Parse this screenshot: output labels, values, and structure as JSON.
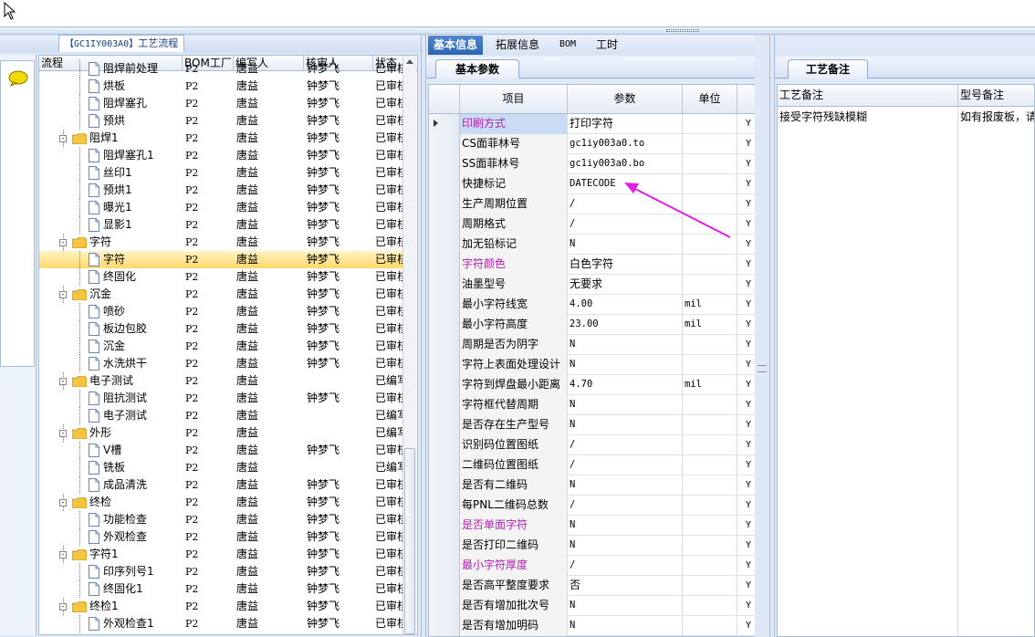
{
  "left": {
    "title_code": "【GC1IY003A0】",
    "title_text": "工艺流程",
    "columns": [
      "流程",
      "BOM工厂",
      "编写人",
      "核审人",
      "状态"
    ],
    "rows": [
      {
        "level": 2,
        "type": "doc",
        "name": "阻焊前处理",
        "bom": "P2",
        "author": "唐益",
        "reviewer": "钟梦飞",
        "status": "已审核"
      },
      {
        "level": 2,
        "type": "doc",
        "name": "烘板",
        "bom": "P2",
        "author": "唐益",
        "reviewer": "钟梦飞",
        "status": "已审核"
      },
      {
        "level": 2,
        "type": "doc",
        "name": "阻焊塞孔",
        "bom": "P2",
        "author": "唐益",
        "reviewer": "钟梦飞",
        "status": "已审核"
      },
      {
        "level": 2,
        "type": "doc",
        "name": "预烘",
        "bom": "P2",
        "author": "唐益",
        "reviewer": "钟梦飞",
        "status": "已审核"
      },
      {
        "level": 1,
        "type": "folder",
        "name": "阻焊1",
        "bom": "P2",
        "author": "唐益",
        "reviewer": "钟梦飞",
        "status": "已审核"
      },
      {
        "level": 2,
        "type": "doc",
        "name": "阻焊塞孔1",
        "bom": "P2",
        "author": "唐益",
        "reviewer": "钟梦飞",
        "status": "已审核"
      },
      {
        "level": 2,
        "type": "doc",
        "name": "丝印1",
        "bom": "P2",
        "author": "唐益",
        "reviewer": "钟梦飞",
        "status": "已审核"
      },
      {
        "level": 2,
        "type": "doc",
        "name": "预烘1",
        "bom": "P2",
        "author": "唐益",
        "reviewer": "钟梦飞",
        "status": "已审核"
      },
      {
        "level": 2,
        "type": "doc",
        "name": "曝光1",
        "bom": "P2",
        "author": "唐益",
        "reviewer": "钟梦飞",
        "status": "已审核"
      },
      {
        "level": 2,
        "type": "doc",
        "name": "显影1",
        "bom": "P2",
        "author": "唐益",
        "reviewer": "钟梦飞",
        "status": "已审核"
      },
      {
        "level": 1,
        "type": "folder",
        "name": "字符",
        "bom": "P2",
        "author": "唐益",
        "reviewer": "钟梦飞",
        "status": "已审核"
      },
      {
        "level": 2,
        "type": "doc",
        "name": "字符",
        "bom": "P2",
        "author": "唐益",
        "reviewer": "钟梦飞",
        "status": "已审核",
        "selected": true
      },
      {
        "level": 2,
        "type": "doc",
        "name": "终固化",
        "bom": "P2",
        "author": "唐益",
        "reviewer": "钟梦飞",
        "status": "已审核"
      },
      {
        "level": 1,
        "type": "folder",
        "name": "沉金",
        "bom": "P2",
        "author": "唐益",
        "reviewer": "钟梦飞",
        "status": "已审核"
      },
      {
        "level": 2,
        "type": "doc",
        "name": "喷砂",
        "bom": "P2",
        "author": "唐益",
        "reviewer": "钟梦飞",
        "status": "已审核"
      },
      {
        "level": 2,
        "type": "doc",
        "name": "板边包胶",
        "bom": "P2",
        "author": "唐益",
        "reviewer": "钟梦飞",
        "status": "已审核"
      },
      {
        "level": 2,
        "type": "doc",
        "name": "沉金",
        "bom": "P2",
        "author": "唐益",
        "reviewer": "钟梦飞",
        "status": "已审核"
      },
      {
        "level": 2,
        "type": "doc",
        "name": "水洗烘干",
        "bom": "P2",
        "author": "唐益",
        "reviewer": "钟梦飞",
        "status": "已审核"
      },
      {
        "level": 1,
        "type": "folder",
        "name": "电子测试",
        "bom": "P2",
        "author": "唐益",
        "reviewer": "",
        "status": "已编写"
      },
      {
        "level": 2,
        "type": "doc",
        "name": "阻抗测试",
        "bom": "P2",
        "author": "唐益",
        "reviewer": "钟梦飞",
        "status": "已审核"
      },
      {
        "level": 2,
        "type": "doc",
        "name": "电子测试",
        "bom": "P2",
        "author": "唐益",
        "reviewer": "",
        "status": "已编写"
      },
      {
        "level": 1,
        "type": "folder",
        "name": "外形",
        "bom": "P2",
        "author": "唐益",
        "reviewer": "",
        "status": "已编写"
      },
      {
        "level": 2,
        "type": "doc",
        "name": "V槽",
        "bom": "P2",
        "author": "唐益",
        "reviewer": "钟梦飞",
        "status": "已审核"
      },
      {
        "level": 2,
        "type": "doc",
        "name": "铣板",
        "bom": "P2",
        "author": "唐益",
        "reviewer": "",
        "status": "已编写"
      },
      {
        "level": 2,
        "type": "doc",
        "name": "成品清洗",
        "bom": "P2",
        "author": "唐益",
        "reviewer": "钟梦飞",
        "status": "已审核"
      },
      {
        "level": 1,
        "type": "folder",
        "name": "终检",
        "bom": "P2",
        "author": "唐益",
        "reviewer": "钟梦飞",
        "status": "已审核"
      },
      {
        "level": 2,
        "type": "doc",
        "name": "功能检查",
        "bom": "P2",
        "author": "唐益",
        "reviewer": "钟梦飞",
        "status": "已审核"
      },
      {
        "level": 2,
        "type": "doc",
        "name": "外观检查",
        "bom": "P2",
        "author": "唐益",
        "reviewer": "钟梦飞",
        "status": "已审核"
      },
      {
        "level": 1,
        "type": "folder",
        "name": "字符1",
        "bom": "P2",
        "author": "唐益",
        "reviewer": "钟梦飞",
        "status": "已审核"
      },
      {
        "level": 2,
        "type": "doc",
        "name": "印序列号1",
        "bom": "P2",
        "author": "唐益",
        "reviewer": "钟梦飞",
        "status": "已审核"
      },
      {
        "level": 2,
        "type": "doc",
        "name": "终固化1",
        "bom": "P2",
        "author": "唐益",
        "reviewer": "钟梦飞",
        "status": "已审核"
      },
      {
        "level": 1,
        "type": "folder",
        "name": "终检1",
        "bom": "P2",
        "author": "唐益",
        "reviewer": "钟梦飞",
        "status": "已审核"
      },
      {
        "level": 2,
        "type": "doc",
        "name": "外观检查1",
        "bom": "P2",
        "author": "唐益",
        "reviewer": "钟梦飞",
        "status": "已审核"
      }
    ]
  },
  "middle": {
    "tabs": [
      "基本信息",
      "拓展信息",
      "BOM",
      "工时"
    ],
    "active_tab": "基本信息",
    "subtab": "基本参数",
    "columns": [
      "项目",
      "参数",
      "单位"
    ],
    "rows": [
      {
        "name": "印刷方式",
        "param": "打印字符",
        "unit": "",
        "flag": "Y",
        "highlight": true,
        "selected": true
      },
      {
        "name": "CS面菲林号",
        "param": "gc1iy003a0.to",
        "unit": "",
        "flag": "Y"
      },
      {
        "name": "SS面菲林号",
        "param": "gc1iy003a0.bo",
        "unit": "",
        "flag": "Y"
      },
      {
        "name": "快捷标记",
        "param": "DATECODE",
        "unit": "",
        "flag": "Y"
      },
      {
        "name": "生产周期位置",
        "param": "/",
        "unit": "",
        "flag": "Y"
      },
      {
        "name": "周期格式",
        "param": "/",
        "unit": "",
        "flag": "Y"
      },
      {
        "name": "加无铅标记",
        "param": "N",
        "unit": "",
        "flag": "Y"
      },
      {
        "name": "字符颜色",
        "param": "白色字符",
        "unit": "",
        "flag": "Y",
        "highlight": true
      },
      {
        "name": "油墨型号",
        "param": "无要求",
        "unit": "",
        "flag": "Y"
      },
      {
        "name": "最小字符线宽",
        "param": "4.00",
        "unit": "mil",
        "flag": "Y"
      },
      {
        "name": "最小字符高度",
        "param": "23.00",
        "unit": "mil",
        "flag": "Y"
      },
      {
        "name": "周期是否为阴字",
        "param": "N",
        "unit": "",
        "flag": "Y"
      },
      {
        "name": "字符上表面处理设计",
        "param": "N",
        "unit": "",
        "flag": "Y"
      },
      {
        "name": "字符到焊盘最小距离",
        "param": "4.70",
        "unit": "mil",
        "flag": "Y"
      },
      {
        "name": "字符框代替周期",
        "param": "N",
        "unit": "",
        "flag": "Y"
      },
      {
        "name": "是否存在生产型号",
        "param": "N",
        "unit": "",
        "flag": "Y"
      },
      {
        "name": "识别码位置图纸",
        "param": "/",
        "unit": "",
        "flag": "Y"
      },
      {
        "name": "二维码位置图纸",
        "param": "/",
        "unit": "",
        "flag": "Y"
      },
      {
        "name": "是否有二维码",
        "param": "N",
        "unit": "",
        "flag": "Y"
      },
      {
        "name": "每PNL二维码总数",
        "param": "/",
        "unit": "",
        "flag": "Y"
      },
      {
        "name": "是否单面字符",
        "param": "N",
        "unit": "",
        "flag": "Y",
        "highlight": true
      },
      {
        "name": "是否打印二维码",
        "param": "N",
        "unit": "",
        "flag": "Y"
      },
      {
        "name": "最小字符厚度",
        "param": "/",
        "unit": "",
        "flag": "Y",
        "highlight": true
      },
      {
        "name": "是否高平整度要求",
        "param": "否",
        "unit": "",
        "flag": "Y"
      },
      {
        "name": "是否有增加批次号",
        "param": "N",
        "unit": "",
        "flag": "Y"
      },
      {
        "name": "是否有增加明码",
        "param": "N",
        "unit": "",
        "flag": "Y"
      }
    ]
  },
  "right": {
    "subtab": "工艺备注",
    "columns": [
      "工艺备注",
      "型号备注"
    ],
    "values": [
      "接受字符残缺模糊",
      "如有报废板，请"
    ]
  },
  "colors": {
    "purple_text": "#b01fb0",
    "arrow": "#e020e0",
    "selected_row": "#ffd96a",
    "tab_active": "#2c65b5"
  }
}
